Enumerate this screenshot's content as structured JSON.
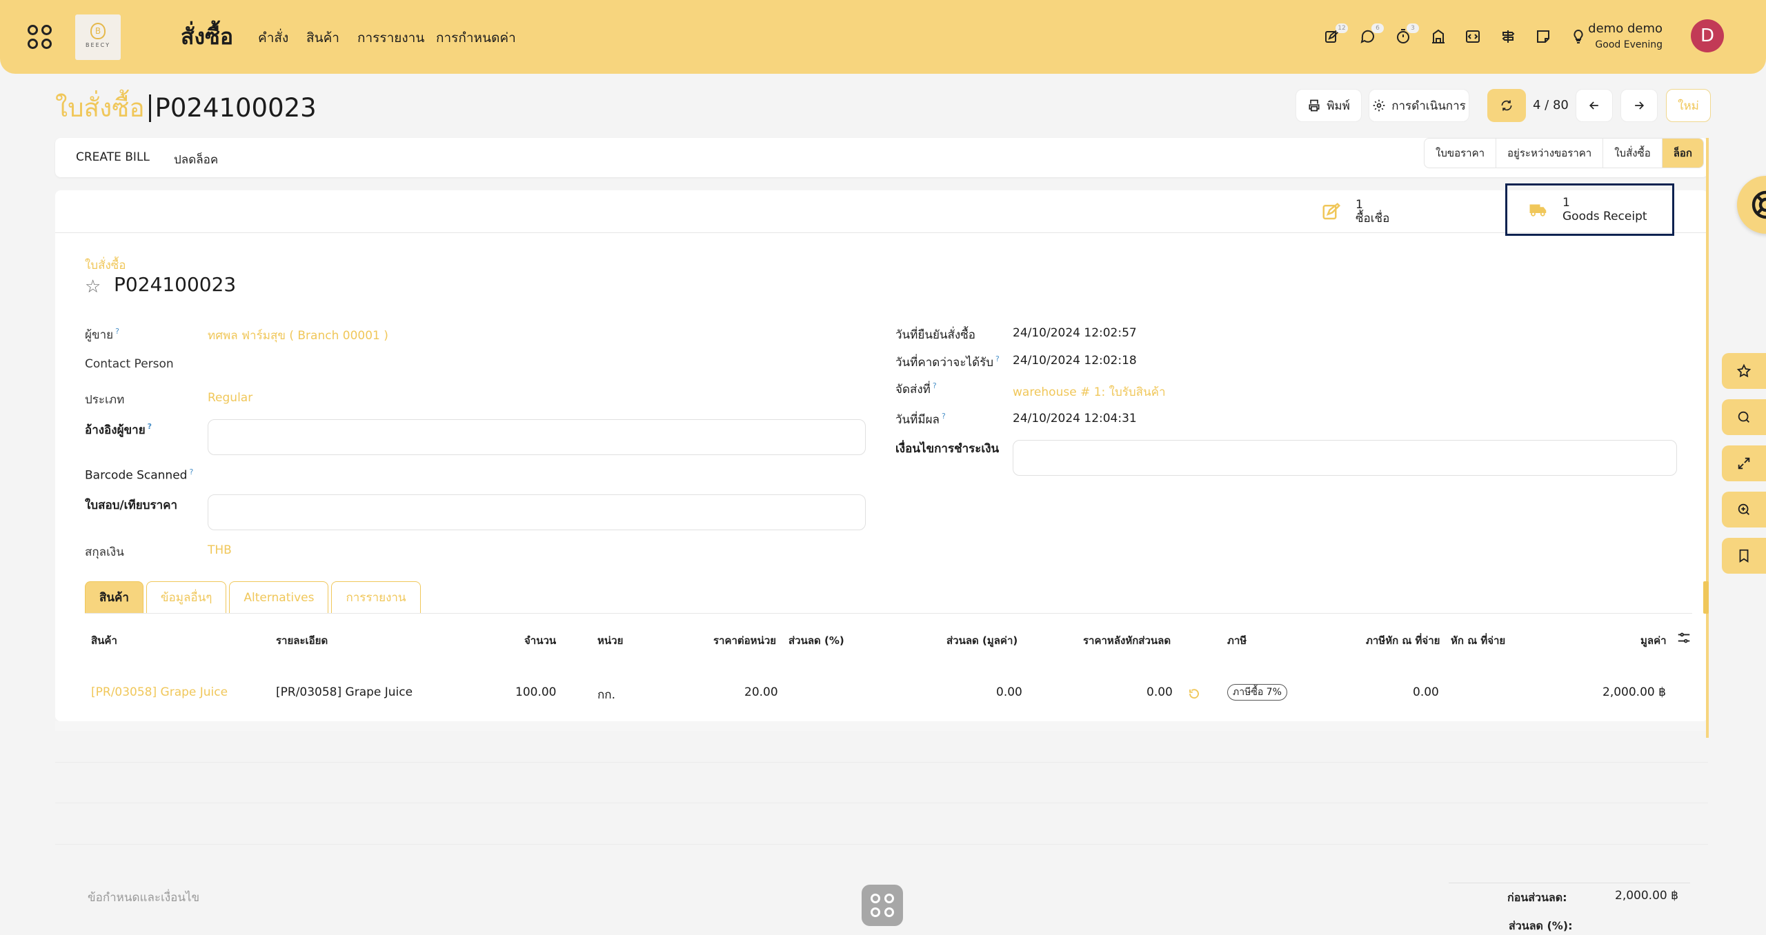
{
  "topbar": {
    "app_title": "สั่งซื้อ",
    "logo_text": "BEECY",
    "menu": [
      "คำสั่ง",
      "สินค้า",
      "การรายงาน",
      "การกำหนดค่า"
    ],
    "badges": {
      "activities": "12",
      "messages": "6",
      "timer": "3"
    },
    "user_name": "demo demo",
    "greeting": "Good Evening",
    "avatar_letter": "D"
  },
  "header": {
    "parent": "ใบสั่งซื้อ",
    "current": "P024100023",
    "print_label": "พิมพ์",
    "actions_label": "การดำเนินการ",
    "pager": "4 / 80",
    "new_label": "ใหม่"
  },
  "actionbar": {
    "create_bill": "CREATE BILL",
    "unlock": "ปลดล็อค",
    "stages": [
      "ใบขอราคา",
      "อยู่ระหว่างขอราคา",
      "ใบสั่งซื้อ",
      "ล็อก"
    ],
    "active_stage": "ล็อก"
  },
  "smart_buttons": {
    "bills_count": "1",
    "bills_label": "ซื้อเชื่อ",
    "receipt_count": "1",
    "receipt_label": "Goods Receipt"
  },
  "form": {
    "doc_label": "ใบสั่งซื้อ",
    "doc_title": "P024100023",
    "vendor_label": "ผู้ขาย",
    "vendor_value": "ทศพล ฟาร์มสุข ( Branch 00001 )",
    "contact_label": "Contact Person",
    "type_label": "ประเภท",
    "type_value": "Regular",
    "vendor_ref_label": "อ้างอิงผู้ขาย",
    "barcode_label": "Barcode Scanned",
    "quotation_label": "ใบสอบ/เทียบราคา",
    "currency_label": "สกุลเงิน",
    "currency_value": "THB",
    "confirm_date_label": "วันที่ยืนยันสั่งซื้อ",
    "confirm_date_value": "24/10/2024 12:02:57",
    "expected_date_label": "วันที่คาดว่าจะได้รับ",
    "expected_date_value": "24/10/2024 12:02:18",
    "deliver_to_label": "จัดส่งที่",
    "deliver_to_value": "warehouse # 1: ใบรับสินค้า",
    "effective_date_label": "วันที่มีผล",
    "effective_date_value": "24/10/2024 12:04:31",
    "payment_terms_label": "เงื่อนไขการชำระเงิน"
  },
  "tabs": [
    "สินค้า",
    "ข้อมูลอื่นๆ",
    "Alternatives",
    "การรายงาน"
  ],
  "table": {
    "headers": [
      "สินค้า",
      "รายละเอียด",
      "จำนวน",
      "หน่วย",
      "ราคาต่อหน่วย",
      "ส่วนลด (%)",
      "ส่วนลด (มูลค่า)",
      "ราคาหลังหักส่วนลด",
      "ภาษี",
      "ภาษีหัก ณ ที่จ่าย",
      "หัก ณ ที่จ่าย",
      "มูลค่า"
    ],
    "rows": [
      {
        "product": "[PR/03058] Grape Juice",
        "description": "[PR/03058] Grape Juice",
        "qty": "100.00",
        "uom": "กก.",
        "unit_price": "20.00",
        "discount_amount": "0.00",
        "price_after_discount": "0.00",
        "tax": "ภาษีซื้อ 7%",
        "wht": "0.00",
        "subtotal": "2,000.00 ฿"
      }
    ]
  },
  "footer": {
    "terms_placeholder": "ข้อกำหนดและเงื่อนไข",
    "before_discount_label": "ก่อนส่วนลด:",
    "before_discount_value": "2,000.00 ฿",
    "discount_pct_label": "ส่วนลด (%):"
  },
  "colors": {
    "accent": "#f7d57e",
    "accent_text": "#f0c75a",
    "focus": "#0c2250",
    "avatar": "#c23a56"
  }
}
